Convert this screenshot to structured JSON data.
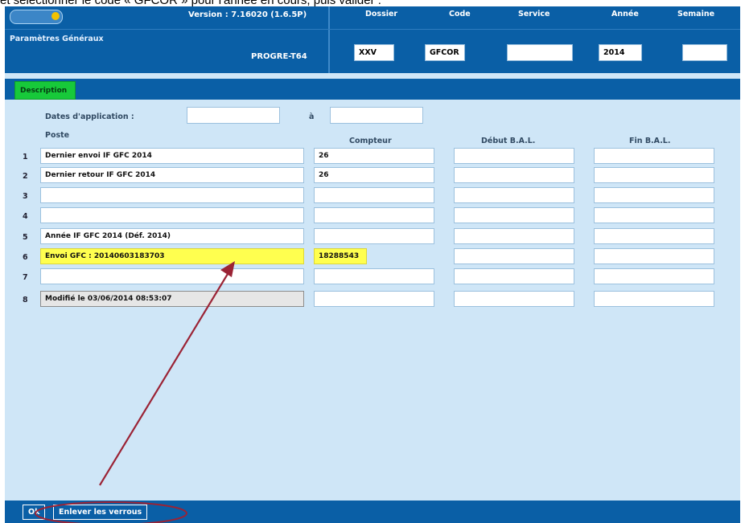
{
  "caption": "et sélectionner le code « GFCOR » pour l'année en cours, puis valider :",
  "header": {
    "version": "Version : 7.16020 (1.6.5P)",
    "subtitle": "Paramètres Généraux",
    "program": "PROGRE-T64",
    "columns": [
      {
        "label": "Dossier",
        "value": "XXV"
      },
      {
        "label": "Code",
        "value": "GFCOR"
      },
      {
        "label": "Service",
        "value": ""
      },
      {
        "label": "Année",
        "value": "2014"
      },
      {
        "label": "Semaine",
        "value": ""
      }
    ]
  },
  "tabs": [
    {
      "label": "Description"
    }
  ],
  "dates": {
    "label": "Dates d'application :",
    "from": "",
    "separator": "à",
    "to": ""
  },
  "columns": {
    "poste": "Poste",
    "compteur": "Compteur",
    "debut": "Début B.A.L.",
    "fin": "Fin B.A.L."
  },
  "rows": [
    {
      "num": "1",
      "poste": "Dernier envoi IF GFC 2014",
      "compteur": "26",
      "debut": "",
      "fin": ""
    },
    {
      "num": "2",
      "poste": "Dernier retour IF GFC 2014",
      "compteur": "26",
      "debut": "",
      "fin": ""
    },
    {
      "num": "3",
      "poste": "",
      "compteur": "",
      "debut": "",
      "fin": ""
    },
    {
      "num": "4",
      "poste": "",
      "compteur": "",
      "debut": "",
      "fin": ""
    },
    {
      "num": "5",
      "poste": "Année IF GFC 2014 (Déf. 2014)",
      "compteur": "",
      "debut": "",
      "fin": ""
    },
    {
      "num": "6",
      "poste": "Envoi GFC : 20140603183703",
      "compteur": "18288543",
      "debut": "",
      "fin": ""
    },
    {
      "num": "7",
      "poste": "",
      "compteur": "",
      "debut": "",
      "fin": ""
    },
    {
      "num": "8",
      "poste": "Modifié le 03/06/2014 08:53:07",
      "compteur": "",
      "debut": "",
      "fin": ""
    }
  ],
  "footer": {
    "ok": "Ok",
    "unlock": "Enlever les verrous"
  },
  "colors": {
    "header": "#0a5fa6",
    "panel": "#cfe6f7",
    "tab_active": "#17c93a",
    "highlight": "#ffff4f",
    "annotation": "#9b2335"
  }
}
